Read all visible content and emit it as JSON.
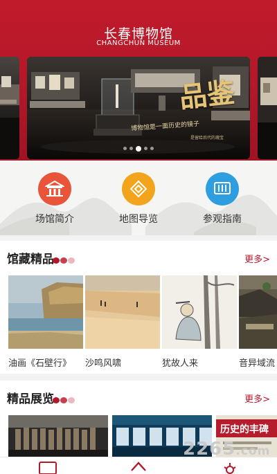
{
  "header": {
    "title": "长春博物馆",
    "subtitle": "CHANGCHUN MUSEUM"
  },
  "banner": {
    "brand": "品鉴",
    "slogan": "博物馆是一面历史的镜子",
    "caption": "是留给后代的瑰宝",
    "slide_count": 5,
    "active_slide": 3
  },
  "quick_links": [
    {
      "label": "场馆简介",
      "icon": "museum-building-icon",
      "color": "#e8553a"
    },
    {
      "label": "地图导览",
      "icon": "map-guide-icon",
      "color": "#f2a51c"
    },
    {
      "label": "参观指南",
      "icon": "guide-scroll-icon",
      "color": "#2f9ee0"
    }
  ],
  "collections": {
    "title": "馆藏精品",
    "more": "更多>",
    "items": [
      {
        "caption": "油画《石壁行》"
      },
      {
        "caption": "沙鸣风啸"
      },
      {
        "caption": "犹故人来"
      },
      {
        "caption": "音异域流"
      }
    ]
  },
  "exhibitions": {
    "title": "精品展览",
    "more": "更多>",
    "third_banner_text": "历史的丰碑"
  },
  "tabbar": {
    "tabs": [
      "tab-card-icon",
      "tab-home-icon",
      "tab-settings-icon"
    ]
  },
  "watermark": {
    "main": "2265",
    "suffix": ".com"
  },
  "colors": {
    "brand_red": "#b3182a",
    "accent_pink": "#e9b9bf"
  }
}
